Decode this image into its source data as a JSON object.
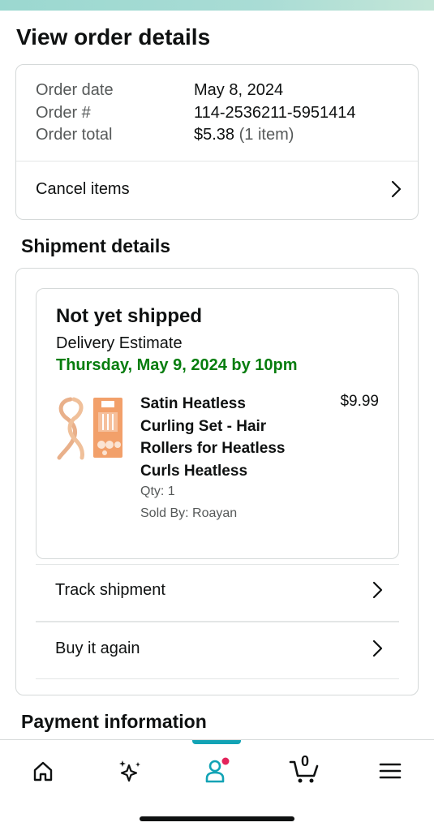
{
  "page": {
    "title": "View order details"
  },
  "order": {
    "date_label": "Order date",
    "date_value": "May 8, 2024",
    "number_label": "Order #",
    "number_value": "114-2536211-5951414",
    "total_label": "Order total",
    "total_value": "$5.38",
    "total_items": "(1 item)",
    "cancel_label": "Cancel items"
  },
  "shipment": {
    "section_title": "Shipment details",
    "status": "Not yet shipped",
    "estimate_label": "Delivery Estimate",
    "estimate_date": "Thursday, May 9, 2024 by 10pm",
    "item": {
      "title_lines": [
        "Satin Heatless",
        "Curling Set - Hair",
        "Rollers for Heatless",
        "Curls Heatless"
      ],
      "price": "$9.99",
      "qty": "Qty: 1",
      "sold_by": "Sold By: Roayan"
    },
    "track_label": "Track shipment",
    "buy_again_label": "Buy it again"
  },
  "payment": {
    "section_title": "Payment information"
  },
  "nav": {
    "items": [
      "home-icon",
      "ai-sparkle-icon",
      "account-icon",
      "cart-icon",
      "menu-icon"
    ],
    "active": "account-icon",
    "cart_count": "0",
    "accent_color": "#12a3b5",
    "badge_color": "#e3245b"
  },
  "colors": {
    "delivery_green": "#067d0e",
    "border": "#d5d9d9"
  }
}
